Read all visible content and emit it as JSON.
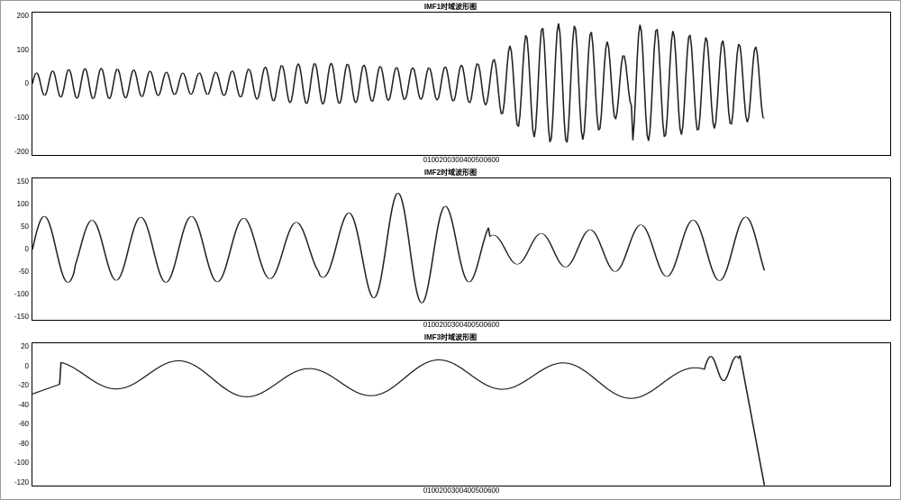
{
  "chart_data": [
    {
      "type": "line",
      "title": "IMF1时域波形图",
      "xlabel": "",
      "ylabel": "",
      "xlim": [
        0,
        600
      ],
      "ylim": [
        -200,
        200
      ],
      "yticks": [
        -200,
        -100,
        0,
        100,
        200
      ],
      "xticks": [
        0,
        100,
        200,
        300,
        400,
        500,
        600
      ],
      "x_end": 512,
      "series": [
        {
          "name": "IMF1",
          "color": "#222"
        }
      ],
      "description": "High-frequency oscillation centered on 0. Amplitude roughly 30–60 over x=0–320, rising to ~150–180 peak around x≈380–420, then ~100 near x≈500."
    },
    {
      "type": "line",
      "title": "IMF2时域波形图",
      "xlabel": "",
      "ylabel": "",
      "xlim": [
        0,
        600
      ],
      "ylim": [
        -150,
        150
      ],
      "yticks": [
        -150,
        -100,
        -50,
        0,
        50,
        100,
        150
      ],
      "xticks": [
        0,
        100,
        200,
        300,
        400,
        500,
        600
      ],
      "x_end": 512,
      "series": [
        {
          "name": "IMF2",
          "color": "#222"
        }
      ],
      "description": "Medium-frequency oscillation centered on 0. Amplitude ~40–70 early, peak ~120 near x≈260, ~50–90 thereafter."
    },
    {
      "type": "line",
      "title": "IMF3时域波形图",
      "xlabel": "",
      "ylabel": "",
      "xlim": [
        0,
        600
      ],
      "ylim": [
        -120,
        20
      ],
      "yticks": [
        -120,
        -100,
        -80,
        -60,
        -40,
        -20,
        0,
        20
      ],
      "xticks": [
        0,
        100,
        200,
        300,
        400,
        500,
        600
      ],
      "x_end": 512,
      "series": [
        {
          "name": "IMF3",
          "color": "#222"
        }
      ],
      "description": "Low-frequency trend oscillating gently between about -30 and +5 for x=0–480, then plunging sharply to about -120 at x≈512."
    }
  ]
}
